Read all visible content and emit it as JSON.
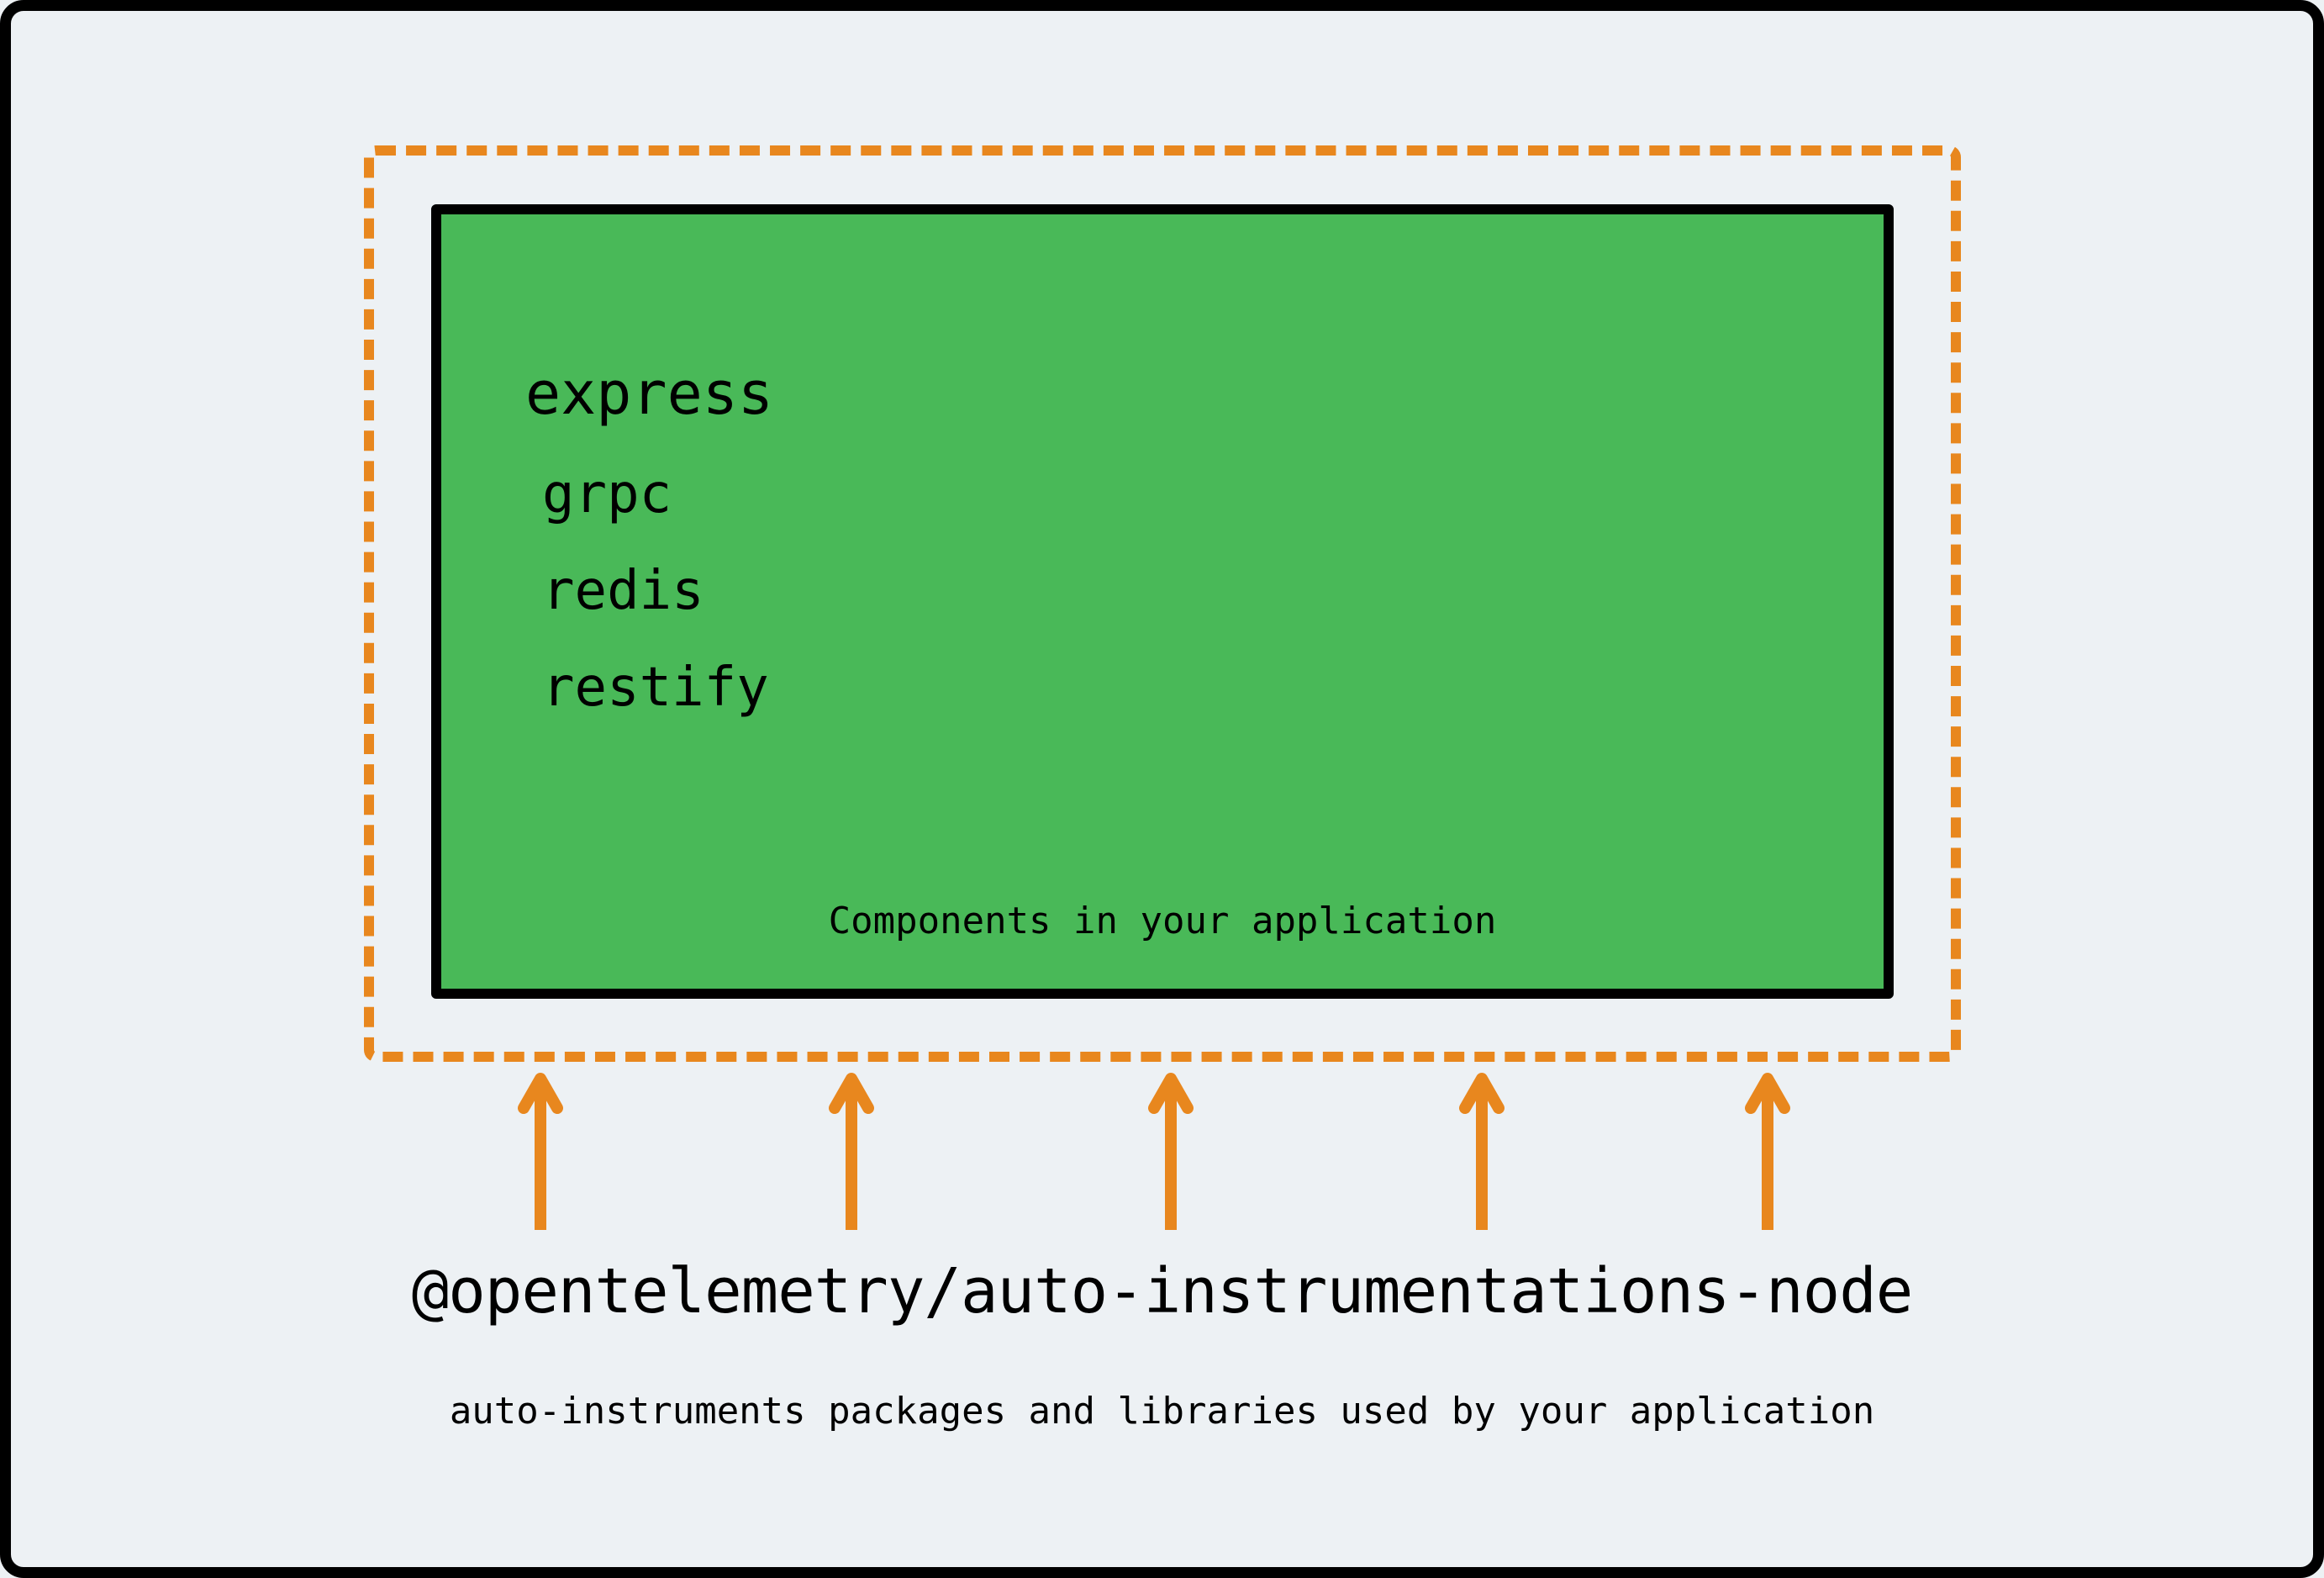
{
  "box": {
    "components": [
      "express",
      "grpc",
      "redis",
      "restify"
    ],
    "caption": "Components in your application"
  },
  "package_name": "@opentelemetry/auto-instrumentations-node",
  "subtitle": "auto-instruments packages and libraries used by your application",
  "colors": {
    "accent_orange": "#E8871E",
    "box_green": "#49B958",
    "page_bg": "#EDF1F4"
  },
  "diagram": {
    "arrow_count": 5,
    "dashed_border": true
  }
}
